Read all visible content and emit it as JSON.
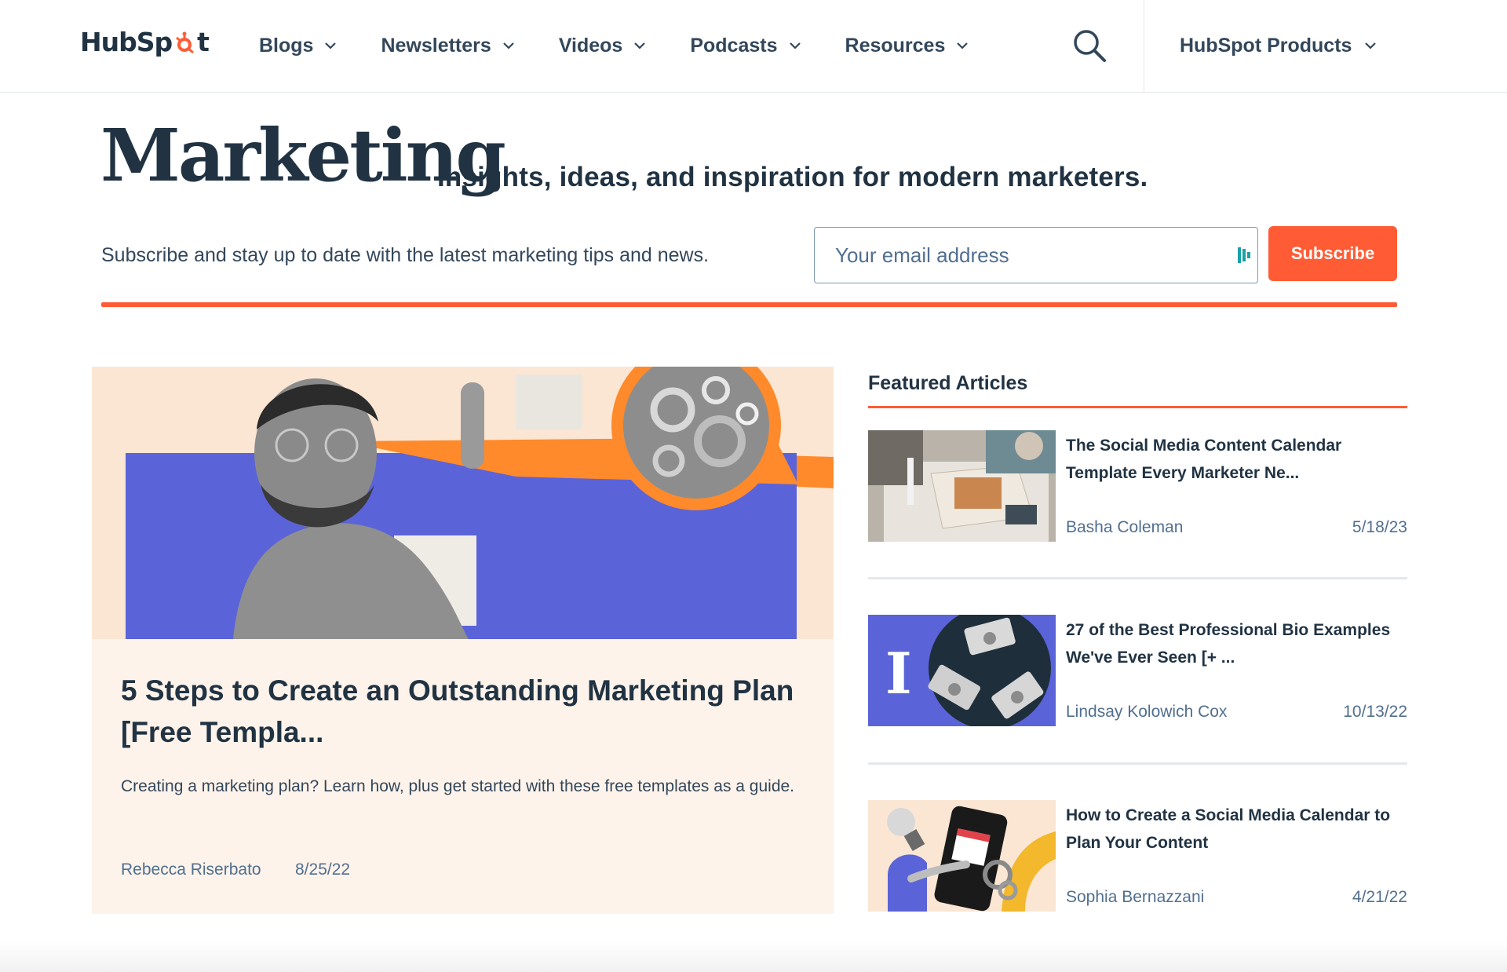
{
  "brand": {
    "logo_text_left": "HubSp",
    "logo_text_right": "t",
    "accent_color": "#ff5c35",
    "navy_color": "#213343"
  },
  "nav": {
    "items": [
      {
        "label": "Blogs"
      },
      {
        "label": "Newsletters"
      },
      {
        "label": "Videos"
      },
      {
        "label": "Podcasts"
      },
      {
        "label": "Resources"
      }
    ],
    "search_icon": "search-icon",
    "products_label": "HubSpot Products"
  },
  "hero": {
    "title": "Marketing",
    "subtitle": "Insights, ideas, and inspiration for modern marketers.",
    "subscribe_text": "Subscribe and stay up to date with the latest marketing tips and news.",
    "email_placeholder": "Your email address",
    "email_value": "",
    "subscribe_button": "Subscribe"
  },
  "main_article": {
    "title": "5 Steps to Create an Outstanding Marketing Plan [Free Templa...",
    "description": "Creating a marketing plan? Learn how, plus get started with these free templates as a guide.",
    "author": "Rebecca Riserbato",
    "date": "8/25/22"
  },
  "featured": {
    "heading": "Featured Articles",
    "articles": [
      {
        "title": "The Social Media Content Calendar Template Every Marketer Ne...",
        "author": "Basha Coleman",
        "date": "5/18/23"
      },
      {
        "title": "27 of the Best Professional Bio Examples We've Ever Seen [+ ...",
        "author": "Lindsay Kolowich Cox",
        "date": "10/13/22"
      },
      {
        "title": "How to Create a Social Media Calendar to Plan Your Content",
        "author": "Sophia Bernazzani",
        "date": "4/21/22"
      }
    ]
  }
}
